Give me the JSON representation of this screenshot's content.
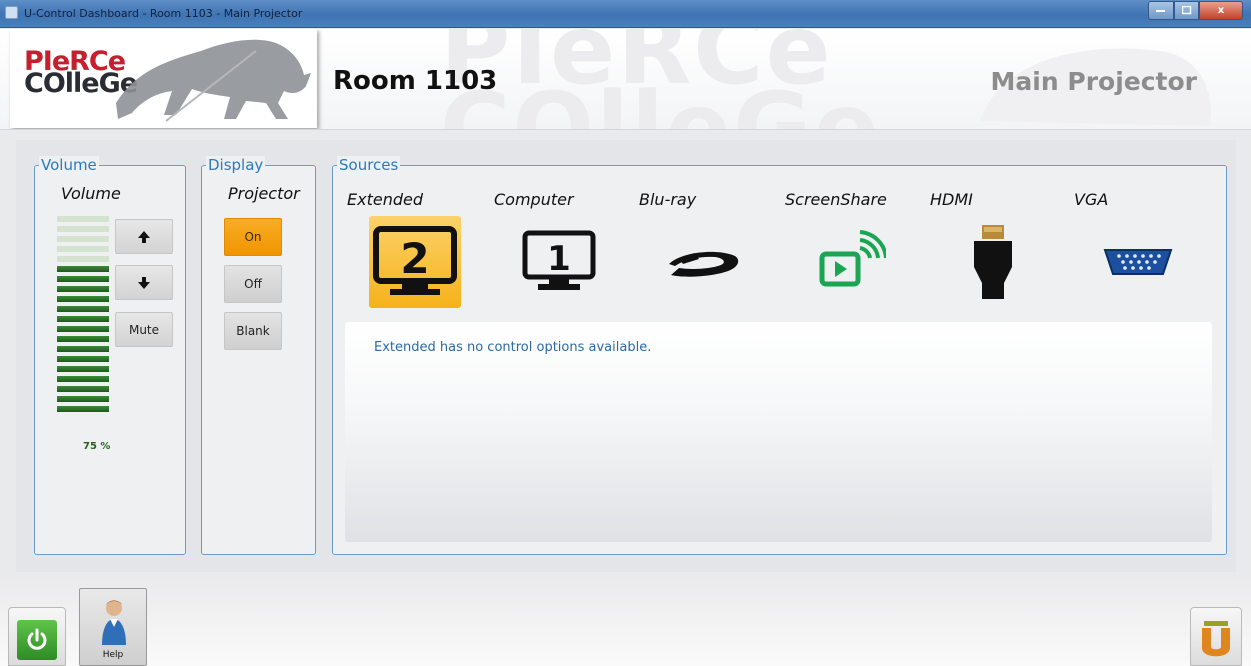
{
  "window": {
    "title": "U-Control Dashboard - Room 1103 - Main Projector",
    "controls": {
      "minimize": "",
      "maximize": "",
      "close": "x"
    }
  },
  "header": {
    "logo_line1": "PIeRCe",
    "logo_line2": "COlleGe",
    "watermark": "PIeRCe COlleGe",
    "room": "Room 1103",
    "device": "Main Projector"
  },
  "volume": {
    "legend": "Volume",
    "label": "Volume",
    "level_percent": 75,
    "level_text": "75 %",
    "bars_total": 20,
    "up_icon": "arrow-up-icon",
    "down_icon": "arrow-down-icon",
    "mute_label": "Mute"
  },
  "display": {
    "legend": "Display",
    "label": "Projector",
    "buttons": [
      {
        "label": "On",
        "active": true
      },
      {
        "label": "Off",
        "active": false
      },
      {
        "label": "Blank",
        "active": false
      }
    ],
    "active_color": "#f39c0b"
  },
  "sources": {
    "legend": "Sources",
    "items": [
      {
        "label": "Extended",
        "icon": "monitor-2-icon",
        "selected": true
      },
      {
        "label": "Computer",
        "icon": "monitor-1-icon",
        "selected": false
      },
      {
        "label": "Blu-ray",
        "icon": "bluray-icon",
        "selected": false
      },
      {
        "label": "ScreenShare",
        "icon": "screenshare-icon",
        "selected": false
      },
      {
        "label": "HDMI",
        "icon": "hdmi-icon",
        "selected": false
      },
      {
        "label": "VGA",
        "icon": "vga-icon",
        "selected": false
      }
    ],
    "message": "Extended has no control options available."
  },
  "footer": {
    "power_icon": "power-icon",
    "help_label": "Help",
    "help_icon": "help-person-icon",
    "brand_icon": "u-control-icon"
  },
  "colors": {
    "accent_blue": "#2a7ac0",
    "meter_green": "#2b6e26",
    "selected_source": "#f5b21a"
  }
}
